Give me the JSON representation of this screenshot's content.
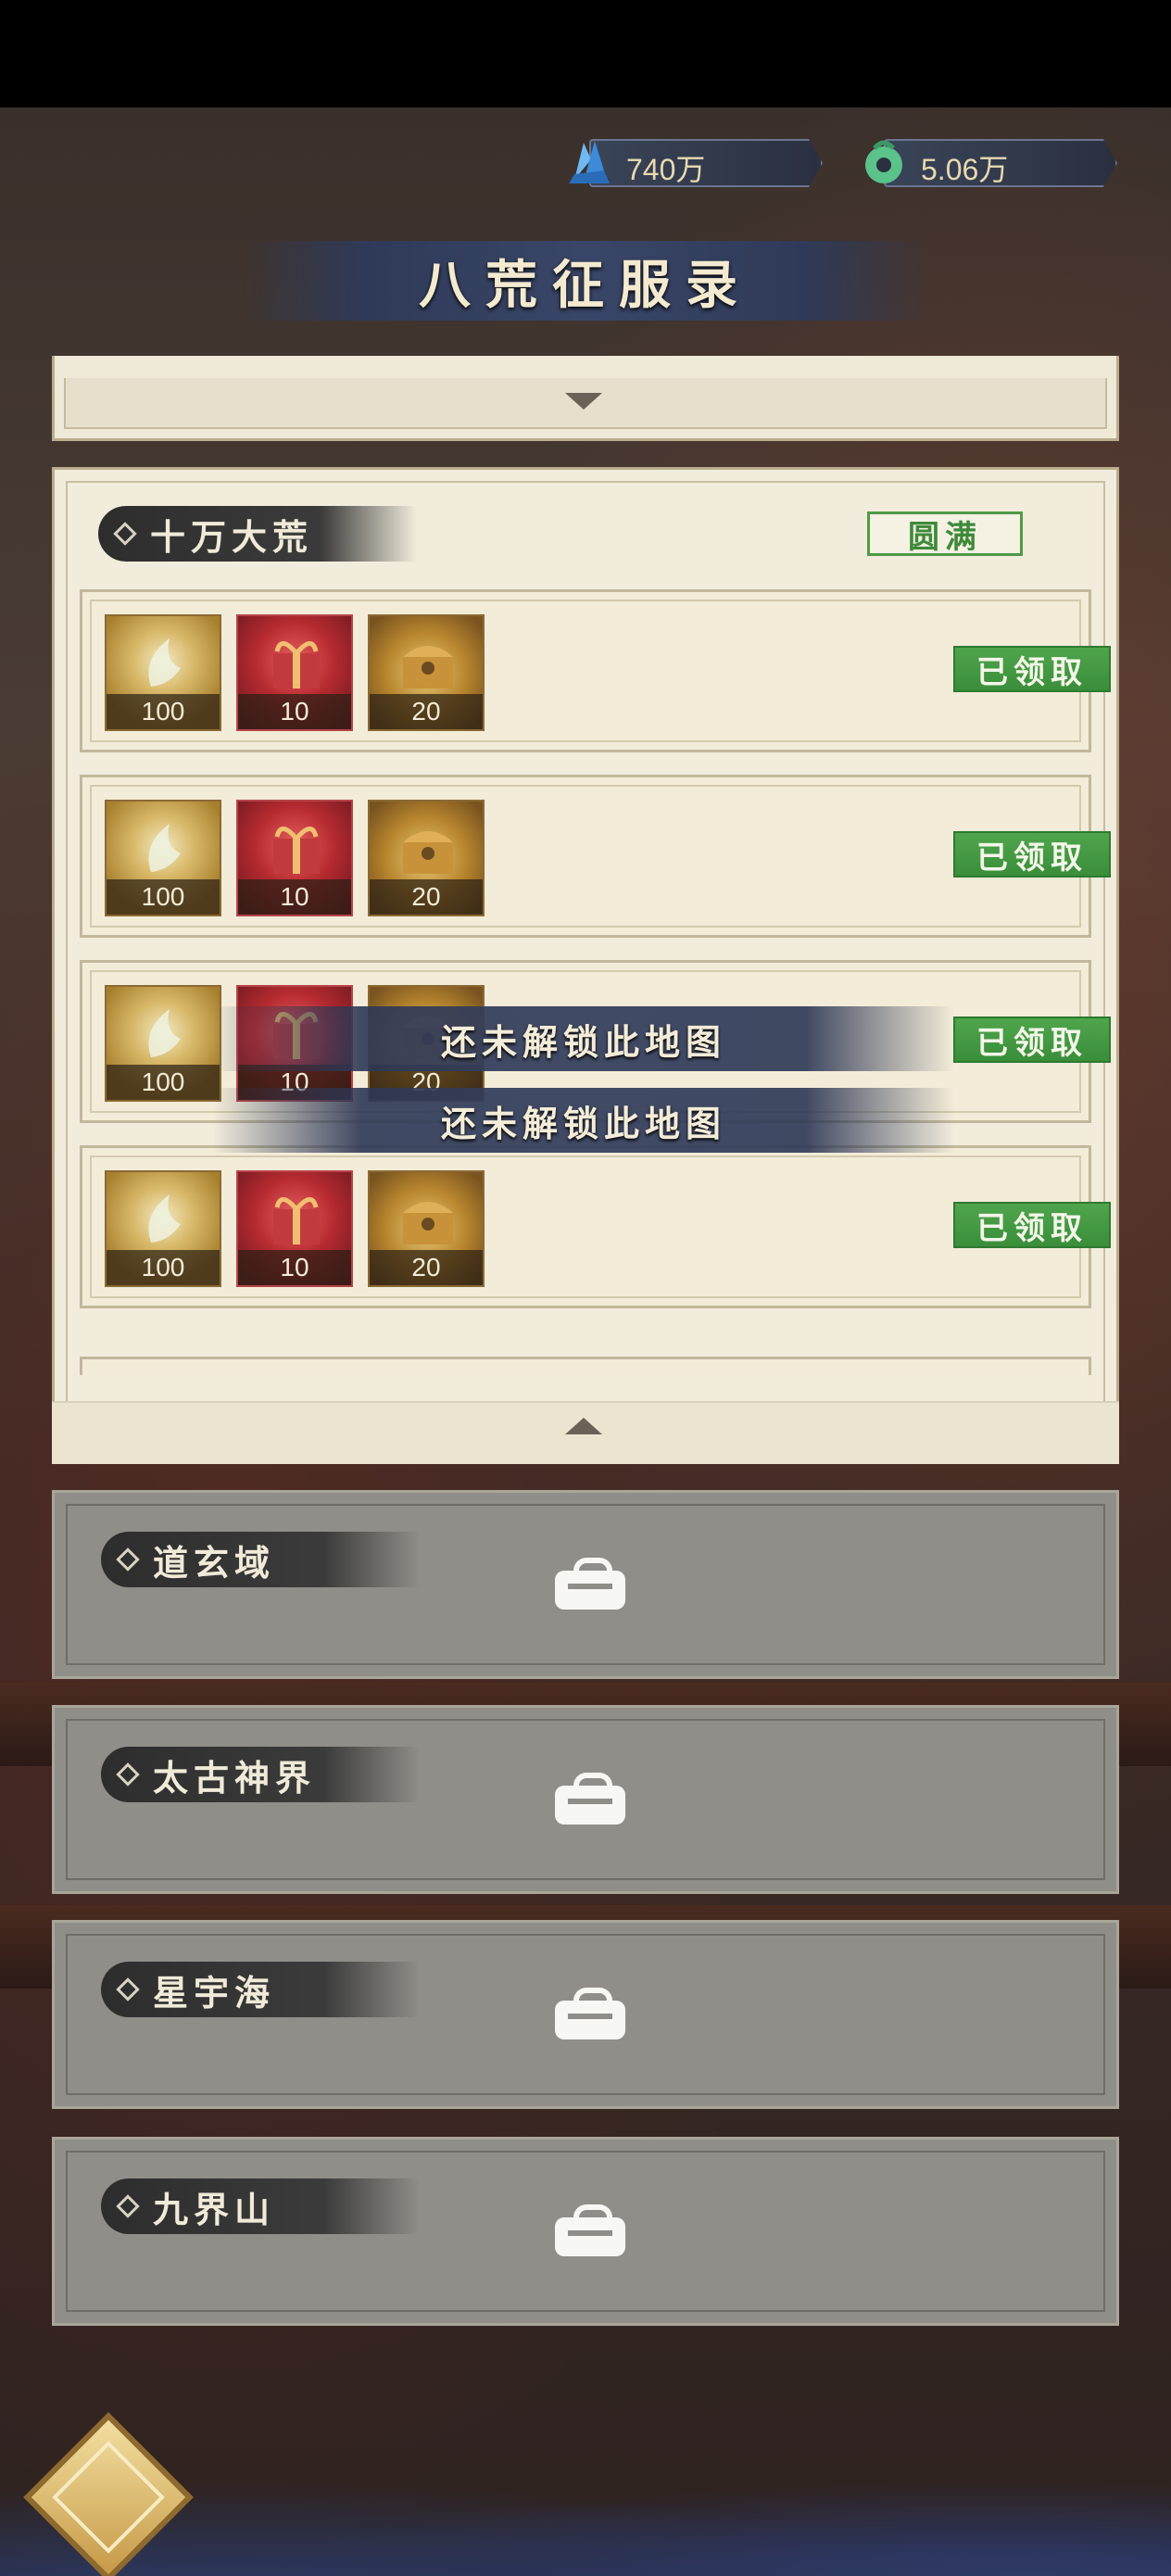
{
  "currencies": [
    {
      "name": "crystal",
      "icon": "blue-crystal-icon",
      "value": "740万"
    },
    {
      "name": "jade",
      "icon": "jade-coin-icon",
      "value": "5.06万"
    }
  ],
  "title": "八荒征服录",
  "active_section": {
    "name": "十万大荒",
    "status": "圆满",
    "rows": [
      {
        "items": [
          {
            "icon": "feather-icon",
            "qty": "100"
          },
          {
            "icon": "gift-icon",
            "qty": "10"
          },
          {
            "icon": "chest-icon",
            "qty": "20"
          }
        ],
        "button": "已领取"
      },
      {
        "items": [
          {
            "icon": "feather-icon",
            "qty": "100"
          },
          {
            "icon": "gift-icon",
            "qty": "10"
          },
          {
            "icon": "chest-icon",
            "qty": "20"
          }
        ],
        "button": "已领取"
      },
      {
        "items": [
          {
            "icon": "feather-icon",
            "qty": "100"
          },
          {
            "icon": "gift-icon",
            "qty": "10"
          },
          {
            "icon": "chest-icon",
            "qty": "20"
          }
        ],
        "button": "已领取"
      },
      {
        "items": [
          {
            "icon": "feather-icon",
            "qty": "100"
          },
          {
            "icon": "gift-icon",
            "qty": "10"
          },
          {
            "icon": "chest-icon",
            "qty": "20"
          }
        ],
        "button": "已领取"
      }
    ]
  },
  "toast": [
    "还未解锁此地图",
    "还未解锁此地图"
  ],
  "locked_sections": [
    {
      "name": "道玄域"
    },
    {
      "name": "太古神界"
    },
    {
      "name": "星宇海"
    },
    {
      "name": "九界山"
    }
  ],
  "colors": {
    "claimed_green": "#3a8e3a",
    "panel_cream": "#f1ecdc",
    "locked_gray": "#8f8e88",
    "title_navy": "#3a4668"
  }
}
